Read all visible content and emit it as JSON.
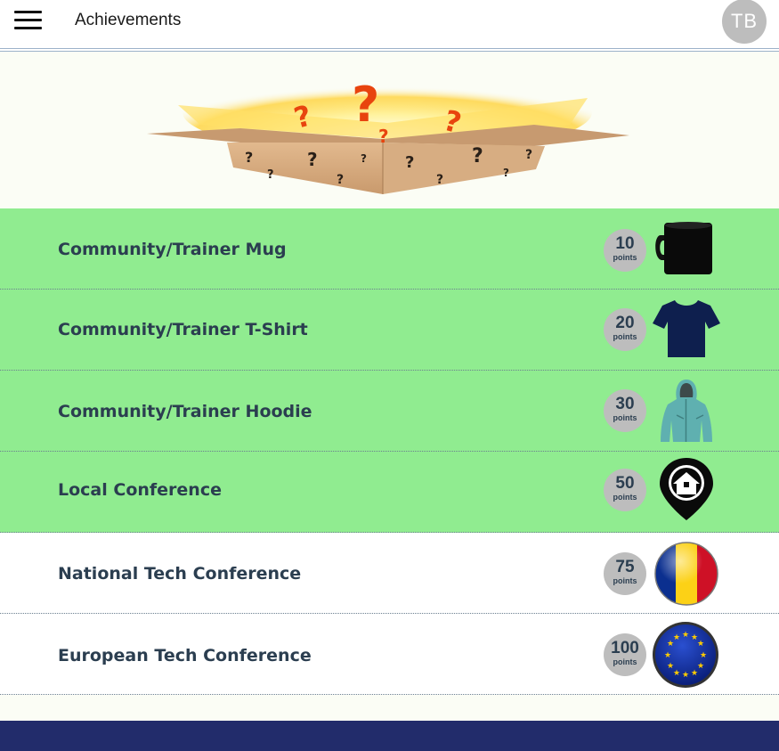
{
  "header": {
    "title": "Achievements",
    "avatar_initials": "TB"
  },
  "achievements": [
    {
      "label": "Community/Trainer Mug",
      "points": "10",
      "points_unit": "points",
      "unlocked": true,
      "icon": "mug-icon"
    },
    {
      "label": "Community/Trainer T-Shirt",
      "points": "20",
      "points_unit": "points",
      "unlocked": true,
      "icon": "tshirt-icon"
    },
    {
      "label": "Community/Trainer Hoodie",
      "points": "30",
      "points_unit": "points",
      "unlocked": true,
      "icon": "hoodie-icon"
    },
    {
      "label": "Local Conference",
      "points": "50",
      "points_unit": "points",
      "unlocked": true,
      "icon": "location-pin-icon"
    },
    {
      "label": "National Tech Conference",
      "points": "75",
      "points_unit": "points",
      "unlocked": false,
      "icon": "romania-flag-icon"
    },
    {
      "label": "European Tech Conference",
      "points": "100",
      "points_unit": "points",
      "unlocked": false,
      "icon": "eu-flag-icon"
    }
  ],
  "colors": {
    "unlocked_row": "#90ec90",
    "locked_row": "#ffffff",
    "badge": "#bdbdbd",
    "text": "#2b3e50",
    "footer": "#222c6b"
  }
}
